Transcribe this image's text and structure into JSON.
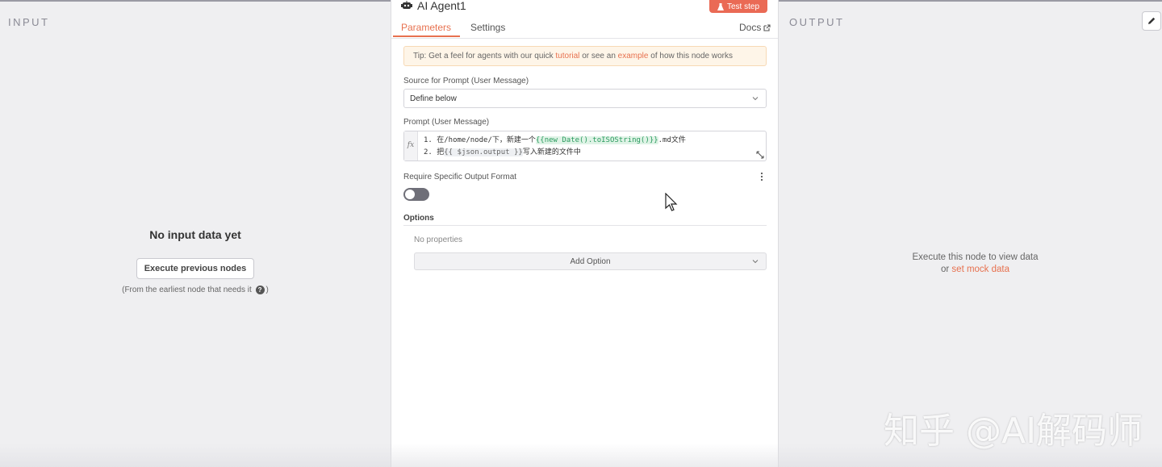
{
  "input_panel": {
    "title": "INPUT",
    "empty_title": "No input data yet",
    "execute_button": "Execute previous nodes",
    "hint": "(From the earliest node that needs it",
    "hint_close": ")"
  },
  "output_panel": {
    "title": "OUTPUT",
    "line1": "Execute this node to view data",
    "line2_prefix": "or",
    "mock_link": "set mock data"
  },
  "node": {
    "title": "AI Agent1",
    "test_button": "Test step",
    "tabs": [
      {
        "label": "Parameters",
        "active": true
      },
      {
        "label": "Settings",
        "active": false
      }
    ],
    "docs_label": "Docs",
    "tip": {
      "prefix": "Tip: Get a feel for agents with our quick",
      "link1": "tutorial",
      "middle": "or see an",
      "link2": "example",
      "suffix": "of how this node works"
    },
    "source_label": "Source for Prompt (User Message)",
    "source_value": "Define below",
    "prompt_label": "Prompt (User Message)",
    "fx_label": "fx",
    "prompt_lines": {
      "l1_prefix": "1. 在/home/node/下，新建一个",
      "l1_expr": "{{new Date().toISOString()}}",
      "l1_suffix": ".md文件",
      "l2_prefix": "2. 把",
      "l2_expr": "{{ $json.output }}",
      "l2_suffix": "写入新建的文件中"
    },
    "format_label": "Require Specific Output Format",
    "format_toggle_on": false,
    "options_label": "Options",
    "no_properties": "No properties",
    "add_option": "Add Option"
  },
  "watermark": "知乎 @AI解码师",
  "colors": {
    "accent": "#e7714f",
    "test_button": "#ea6a55",
    "expression_green": "#2b9b5f"
  }
}
